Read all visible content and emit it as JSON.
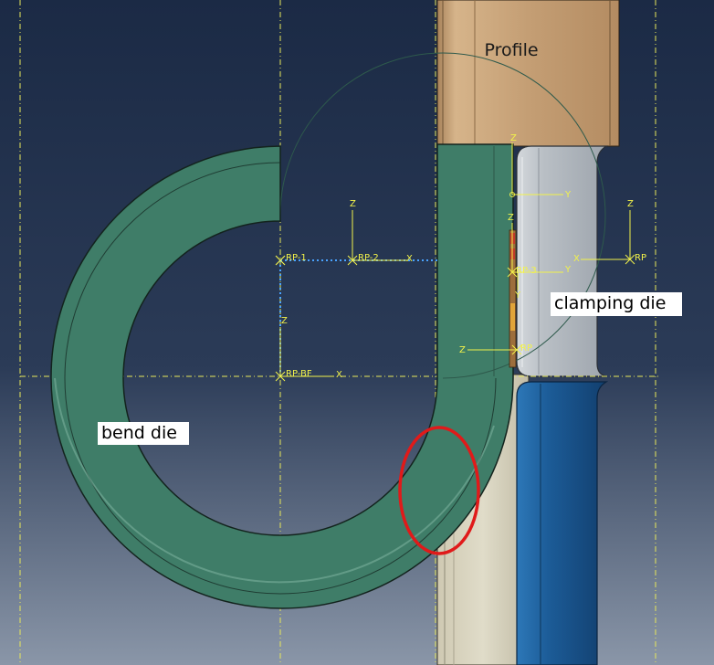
{
  "labels": {
    "profile": "Profile",
    "clamping_die": "clamping die",
    "bend_die": "bend die"
  },
  "reference_points": {
    "rp1": "RP-1",
    "rp2": "RP-2",
    "rp3": "RP-3",
    "rp_bf": "RP-BF",
    "rp_clamp": "RP",
    "rp_right": "RP"
  },
  "axes": {
    "x": "X",
    "y": "Y",
    "z": "Z"
  },
  "colors": {
    "background_top": "#1b2a45",
    "background_bottom": "#8a96a8",
    "bend_die": "#3f7d68",
    "profile": "#c9a57c",
    "clamping_die": "#b8bec4",
    "lower_die": "#1f5f9c",
    "highlight_circle": "#e01a1a",
    "csys": "#f2f24a"
  }
}
